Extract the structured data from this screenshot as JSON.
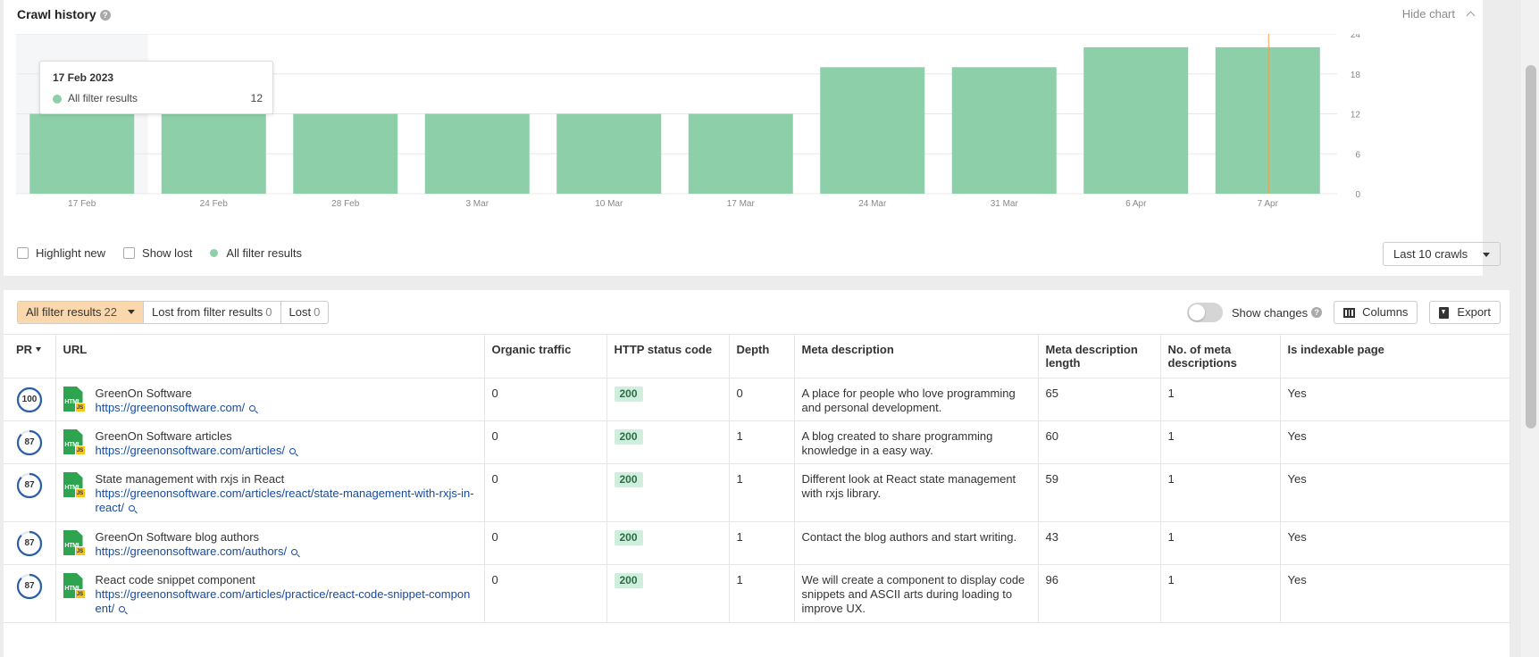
{
  "crawl_history": {
    "title": "Crawl history",
    "hide_chart_label": "Hide chart",
    "tooltip": {
      "date": "17 Feb 2023",
      "series_label": "All filter results",
      "value": "12"
    },
    "legend": {
      "highlight_new": "Highlight new",
      "show_lost": "Show lost",
      "all_filter_results": "All filter results"
    },
    "range_select": "Last 10 crawls"
  },
  "chart_data": {
    "type": "bar",
    "categories": [
      "17 Feb",
      "24 Feb",
      "28 Feb",
      "3 Mar",
      "10 Mar",
      "17 Mar",
      "24 Mar",
      "31 Mar",
      "6 Apr",
      "7 Apr"
    ],
    "series": [
      {
        "name": "All filter results",
        "values": [
          12,
          12,
          12,
          12,
          12,
          12,
          19,
          19,
          22,
          22
        ]
      }
    ],
    "y_ticks": [
      "0",
      "6",
      "12",
      "18",
      "24"
    ],
    "ylim": [
      0,
      24
    ],
    "grid": true,
    "highlighted_category": "17 Feb",
    "marker_category": "7 Apr",
    "bar_color": "#8ccfa9",
    "marker_color": "#f0a04b"
  },
  "filter_tabs": [
    {
      "label": "All filter results",
      "count": "22",
      "active": true
    },
    {
      "label": "Lost from filter results",
      "count": "0",
      "active": false
    },
    {
      "label": "Lost",
      "count": "0",
      "active": false
    }
  ],
  "toolbar": {
    "show_changes": "Show changes",
    "columns": "Columns",
    "export": "Export"
  },
  "table": {
    "columns": [
      "PR",
      "URL",
      "Organic traffic",
      "HTTP status code",
      "Depth",
      "Meta description",
      "Meta description length",
      "No. of meta descriptions",
      "Is indexable page"
    ],
    "rows": [
      {
        "pr": "100",
        "pr_fill": 1.0,
        "title": "GreenOn Software",
        "url": "https://greenonsoftware.com/",
        "traffic": "0",
        "status": "200",
        "depth": "0",
        "meta": "A place for people who love programming and personal development.",
        "meta_len": "65",
        "meta_count": "1",
        "indexable": "Yes"
      },
      {
        "pr": "87",
        "pr_fill": 0.87,
        "title": "GreenOn Software articles",
        "url": "https://greenonsoftware.com/articles/",
        "traffic": "0",
        "status": "200",
        "depth": "1",
        "meta": "A blog created to share programming knowledge in a easy way.",
        "meta_len": "60",
        "meta_count": "1",
        "indexable": "Yes"
      },
      {
        "pr": "87",
        "pr_fill": 0.87,
        "title": "State management with rxjs in React",
        "url": "https://greenonsoftware.com/articles/react/state-management-with-rxjs-in-react/",
        "traffic": "0",
        "status": "200",
        "depth": "1",
        "meta": "Different look at React state management with rxjs library.",
        "meta_len": "59",
        "meta_count": "1",
        "indexable": "Yes"
      },
      {
        "pr": "87",
        "pr_fill": 0.87,
        "title": "GreenOn Software blog authors",
        "url": "https://greenonsoftware.com/authors/",
        "traffic": "0",
        "status": "200",
        "depth": "1",
        "meta": "Contact the blog authors and start writing.",
        "meta_len": "43",
        "meta_count": "1",
        "indexable": "Yes"
      },
      {
        "pr": "87",
        "pr_fill": 0.87,
        "title": "React code snippet component",
        "url": "https://greenonsoftware.com/articles/practice/react-code-snippet-component/",
        "traffic": "0",
        "status": "200",
        "depth": "1",
        "meta": "We will create a component to display code snippets and ASCII arts during loading to improve UX.",
        "meta_len": "96",
        "meta_count": "1",
        "indexable": "Yes"
      }
    ]
  },
  "icons": {
    "help": "help-icon",
    "collapse": "chevron-up-icon",
    "columns": "columns-icon",
    "export": "export-icon",
    "search": "search-icon",
    "file": "html-js-file-icon"
  }
}
